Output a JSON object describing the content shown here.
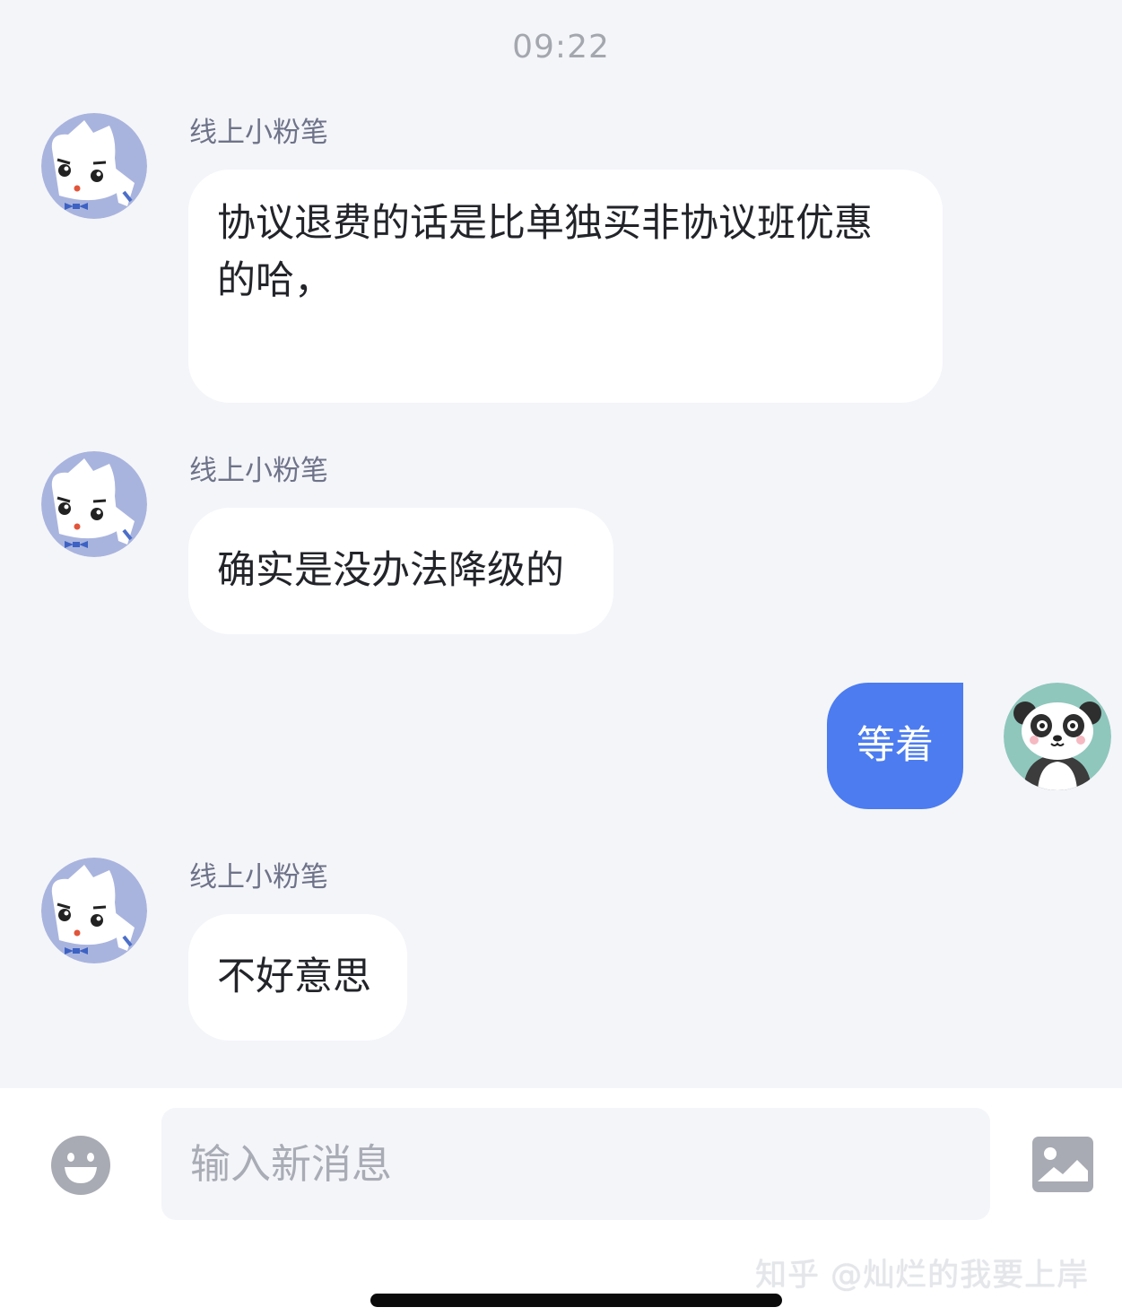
{
  "timestamp": "09:22",
  "messages": [
    {
      "sender": "线上小粉笔",
      "lines": [
        "协议退费的话是比单独买非协议班优惠",
        "的哈，"
      ]
    },
    {
      "sender": "线上小粉笔",
      "text": "确实是没办法降级的"
    },
    {
      "self_text": "等着"
    },
    {
      "sender": "线上小粉笔",
      "text": "不好意思"
    }
  ],
  "composer": {
    "placeholder": "输入新消息",
    "emoji_icon": "emoji-icon",
    "image_icon": "image-icon"
  },
  "watermark": "知乎 @灿烂的我要上岸",
  "colors": {
    "background": "#f4f5f9",
    "outgoing_bubble": "#4c7cf0",
    "incoming_bubble": "#ffffff",
    "sender_name": "#6e7389"
  }
}
